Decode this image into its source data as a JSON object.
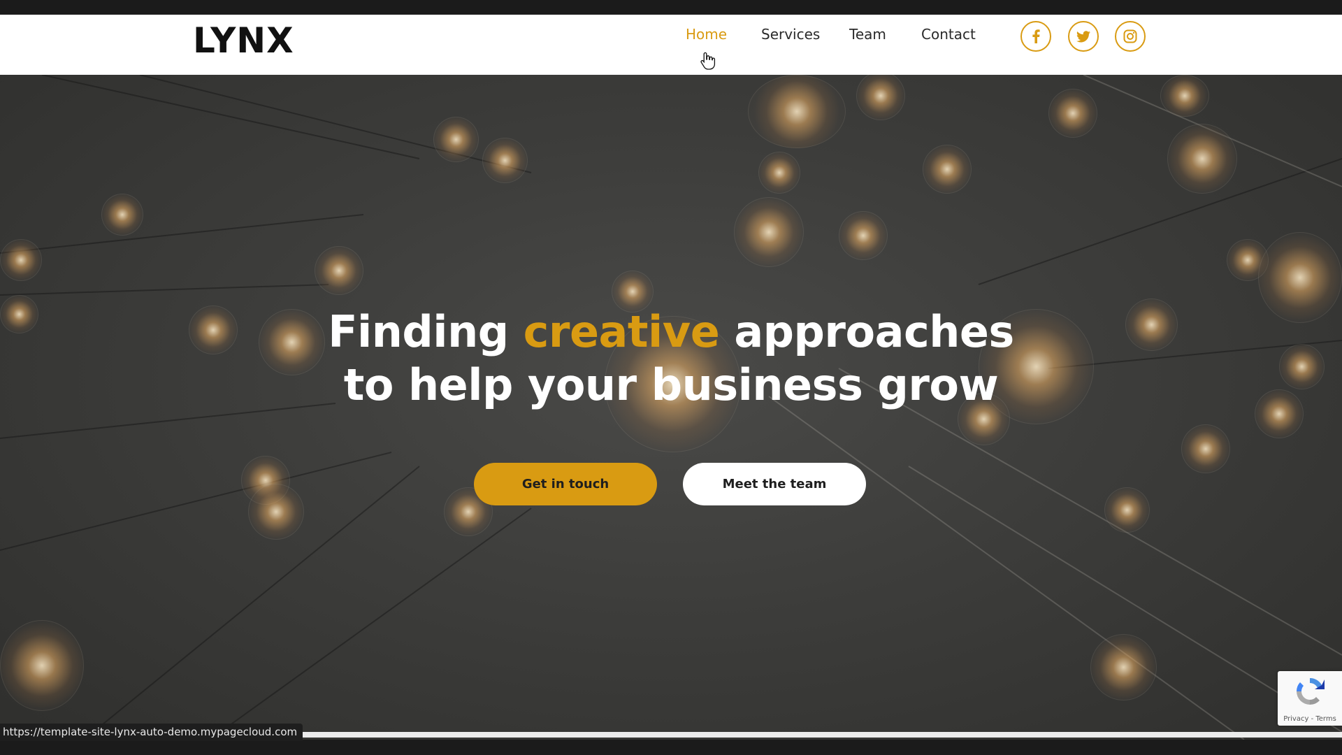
{
  "brand": {
    "logo_text": "LYNX"
  },
  "nav": {
    "items": [
      {
        "label": "Home",
        "active": true
      },
      {
        "label": "Services",
        "active": false
      },
      {
        "label": "Team",
        "active": false
      },
      {
        "label": "Contact",
        "active": false
      }
    ],
    "social": [
      {
        "icon": "facebook-icon"
      },
      {
        "icon": "twitter-icon"
      },
      {
        "icon": "instagram-icon"
      }
    ]
  },
  "hero": {
    "headline_pre": "Finding ",
    "headline_accent": "creative",
    "headline_post_line1": " approaches",
    "headline_line2": "to help your business grow",
    "primary_button": "Get in touch",
    "secondary_button": "Meet the team"
  },
  "status_bar": {
    "url": "https://template-site-lynx-auto-demo.mypagecloud.com"
  },
  "recaptcha": {
    "terms": "Privacy - Terms"
  },
  "colors": {
    "accent": "#d99b12",
    "text_dark": "#2a2a2a",
    "hero_bg": "#3d3d3b"
  }
}
